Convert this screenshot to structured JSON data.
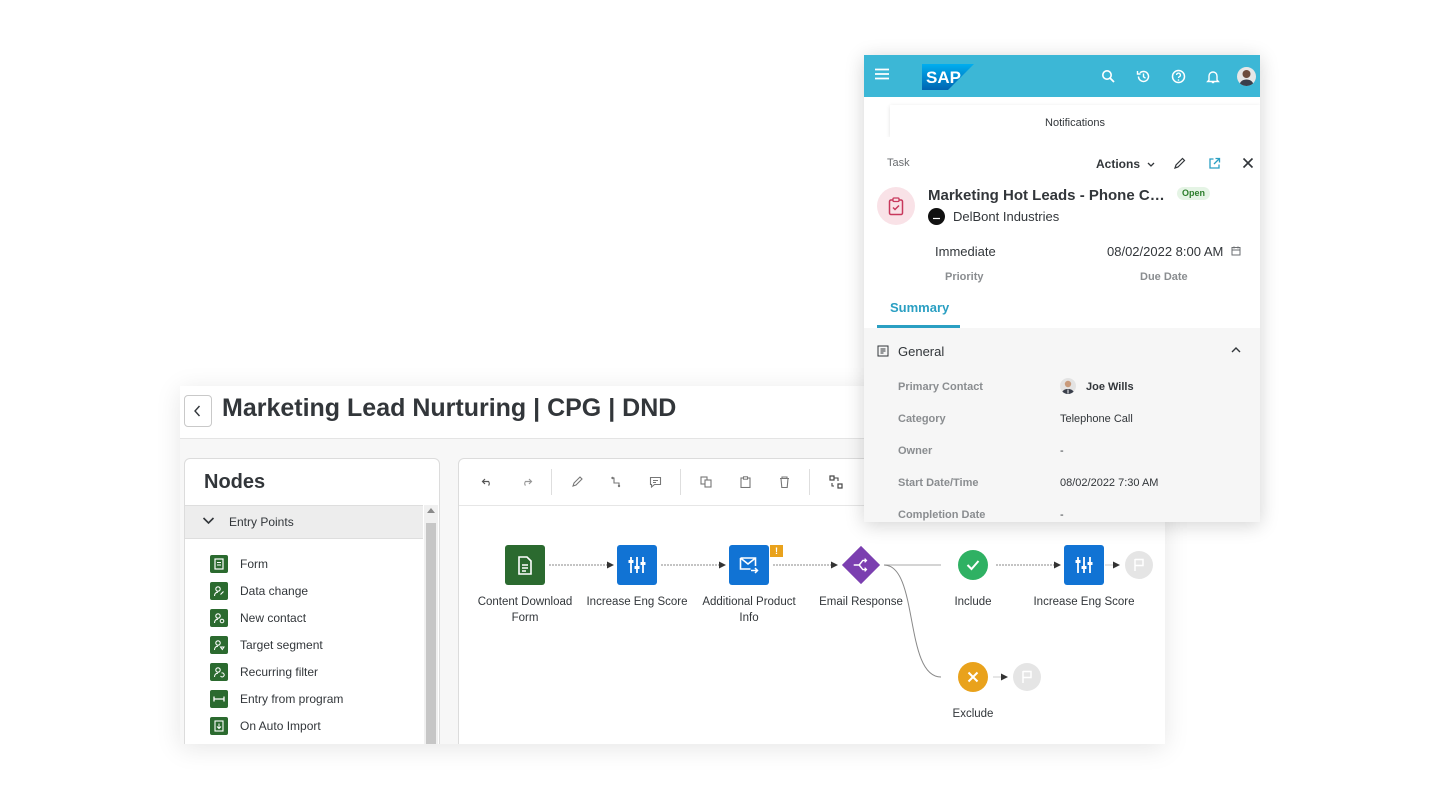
{
  "builder": {
    "title": "Marketing Lead Nurturing | CPG | DND",
    "nodes_panel": {
      "title": "Nodes",
      "group_label": "Entry Points",
      "items": [
        {
          "label": "Form",
          "icon": "form-icon"
        },
        {
          "label": "Data change",
          "icon": "data-change-icon"
        },
        {
          "label": "New contact",
          "icon": "new-contact-icon"
        },
        {
          "label": "Target segment",
          "icon": "target-segment-icon"
        },
        {
          "label": "Recurring filter",
          "icon": "recurring-filter-icon"
        },
        {
          "label": "Entry from program",
          "icon": "entry-program-icon"
        },
        {
          "label": "On Auto Import",
          "icon": "auto-import-icon"
        }
      ]
    },
    "toolbar": [
      "undo-icon",
      "redo-icon",
      "edit-icon",
      "connect-icon",
      "comment-icon",
      "copy-icon",
      "paste-icon",
      "delete-icon",
      "fit-view-icon"
    ],
    "flow": {
      "nodes": [
        {
          "label": "Content Download Form",
          "icon": "document-icon",
          "color": "#2b6a2f"
        },
        {
          "label": "Increase Eng Score",
          "icon": "sliders-icon",
          "color": "#1173d4"
        },
        {
          "label": "Additional Product Info",
          "icon": "email-icon",
          "color": "#1173d4",
          "badge": "!"
        },
        {
          "label": "Email Response",
          "icon": "split-icon",
          "color": "#7b3fb0"
        },
        {
          "label": "Include",
          "icon": "check-icon",
          "color": "#2fb163"
        },
        {
          "label": "Increase Eng Score",
          "icon": "sliders-icon",
          "color": "#1173d4"
        },
        {
          "label": "Exclude",
          "icon": "cross-icon",
          "color": "#e9a21c"
        }
      ]
    }
  },
  "sap_window": {
    "brand": "SAP",
    "shell_icons": [
      "search-icon",
      "history-icon",
      "help-icon",
      "bell-icon"
    ],
    "notifications_label": "Notifications",
    "task_type": "Task",
    "actions_label": "Actions",
    "title": "Marketing Hot Leads - Phone Call to discuss",
    "status": "Open",
    "company": "DelBont Industries",
    "priority_value": "Immediate",
    "priority_label": "Priority",
    "due_value": "08/02/2022 8:00 AM",
    "due_label": "Due Date",
    "tab_label": "Summary",
    "section_title": "General",
    "fields": [
      {
        "label": "Primary Contact",
        "value": "Joe Wills"
      },
      {
        "label": "Category",
        "value": "Telephone Call"
      },
      {
        "label": "Owner",
        "value": "-"
      },
      {
        "label": "Start Date/Time",
        "value": "08/02/2022 7:30 AM"
      },
      {
        "label": "Completion Date",
        "value": "-"
      }
    ]
  },
  "colors": {
    "shellbar": "#3cb7d6",
    "accent": "#2a9fc2",
    "entry_green": "#2b6a2f"
  }
}
